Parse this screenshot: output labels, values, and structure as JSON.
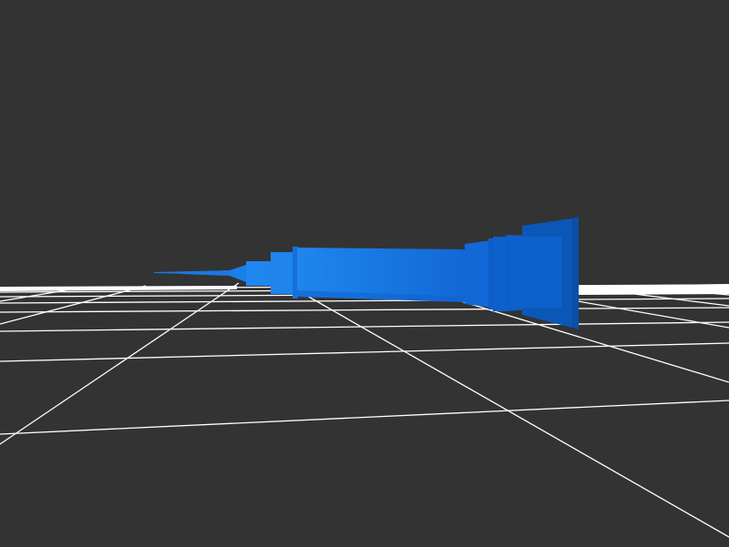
{
  "scene": {
    "background_color": "#333333",
    "grid_color": "#ffffff",
    "object": {
      "name": "syringe",
      "primary_color": "#1a7ae8",
      "shade_color": "#0d5fc4",
      "dark_color": "#0a50ad"
    }
  }
}
